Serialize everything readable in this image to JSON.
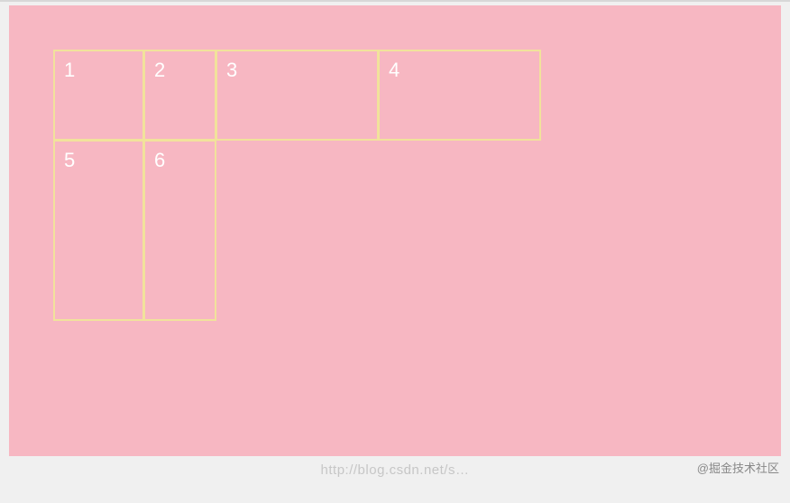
{
  "cells": {
    "c1": "1",
    "c2": "2",
    "c3": "3",
    "c4": "4",
    "c5": "5",
    "c6": "6"
  },
  "watermarks": {
    "right": "@掘金技术社区",
    "center": "http://blog.csdn.net/s…"
  },
  "colors": {
    "background": "#f7b7c2",
    "border": "#f1e29b",
    "text": "#ffffff"
  }
}
